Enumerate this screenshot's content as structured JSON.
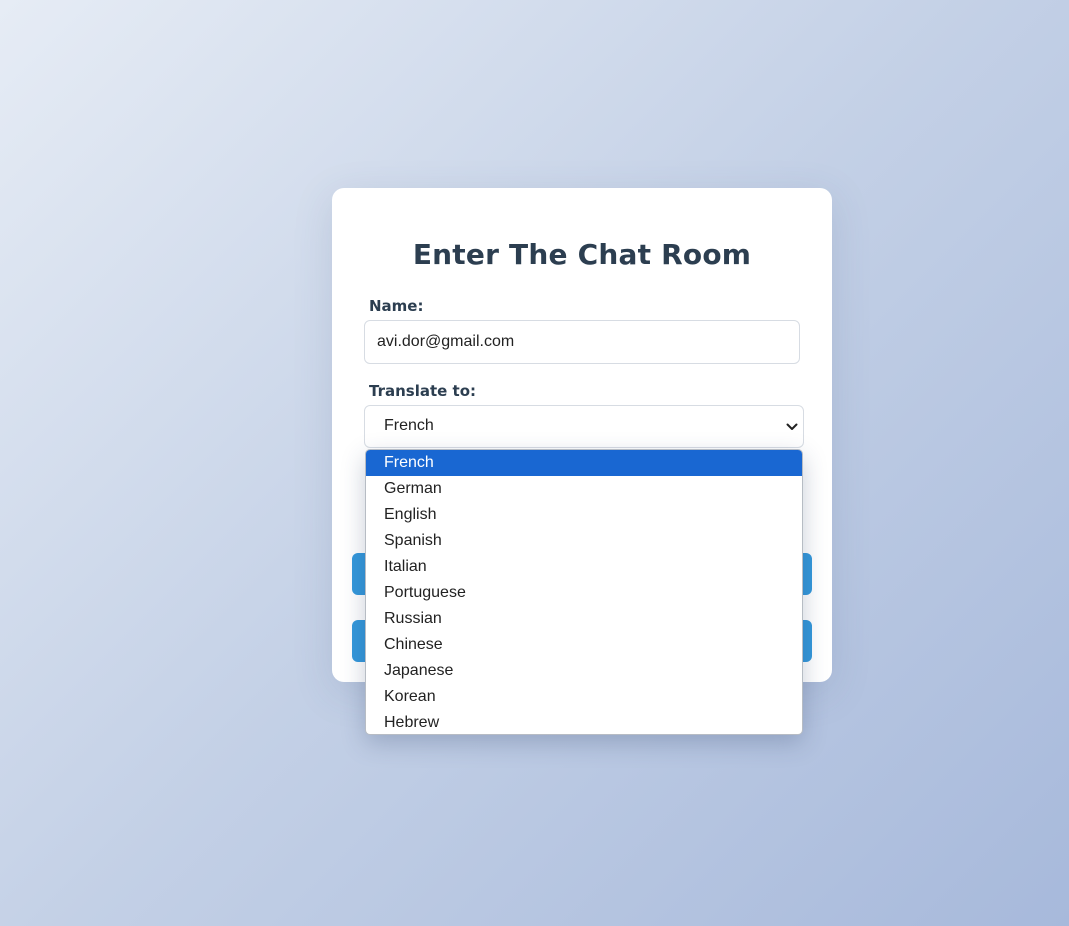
{
  "form": {
    "title": "Enter The Chat Room",
    "name_label": "Name:",
    "name_value": "avi.dor@gmail.com",
    "translate_label": "Translate to:",
    "selected_language": "French"
  },
  "dropdown": {
    "options": [
      "French",
      "German",
      "English",
      "Spanish",
      "Italian",
      "Portuguese",
      "Russian",
      "Chinese",
      "Japanese",
      "Korean",
      "Hebrew"
    ],
    "highlighted_index": 0
  },
  "colors": {
    "button": "#3498db",
    "highlight": "#1967d2",
    "title": "#2c3e50"
  }
}
